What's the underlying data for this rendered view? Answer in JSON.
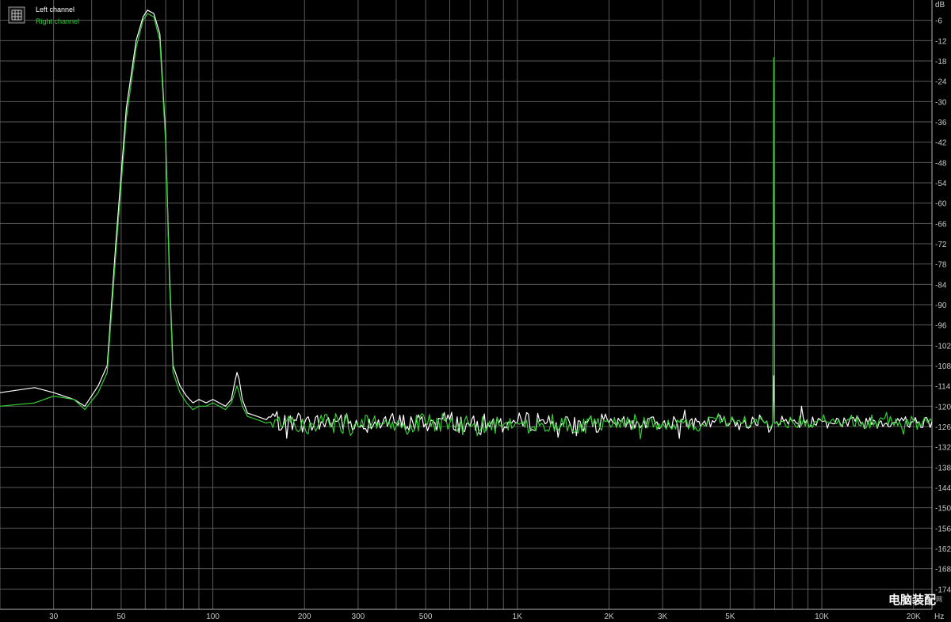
{
  "chart_data": {
    "type": "line",
    "title": "",
    "xlabel": "",
    "ylabel": "",
    "y_unit": "dB",
    "x_unit": "Hz",
    "x_scale": "log",
    "xlim": [
      20,
      23000
    ],
    "ylim": [
      -180,
      0
    ],
    "grid": true,
    "legend_position": "top-left",
    "background_color": "#000000",
    "grid_color": "#5a5a5a",
    "x_tick_labels": [
      "30",
      "50",
      "100",
      "200",
      "300",
      "500",
      "1K",
      "2K",
      "3K",
      "5K",
      "10K",
      "20K"
    ],
    "x_tick_values": [
      30,
      50,
      100,
      200,
      300,
      500,
      1000,
      2000,
      3000,
      5000,
      10000,
      20000
    ],
    "y_tick_values": [
      -6,
      -12,
      -18,
      -24,
      -30,
      -36,
      -42,
      -48,
      -54,
      -60,
      -66,
      -72,
      -78,
      -84,
      -90,
      -96,
      -102,
      -108,
      -114,
      -120,
      -126,
      -132,
      -138,
      -144,
      -150,
      -156,
      -162,
      -168,
      -174
    ],
    "y_tick_labels": [
      "-6",
      "-12",
      "-18",
      "-24",
      "-30",
      "-36",
      "-42",
      "-48",
      "-54",
      "-60",
      "-66",
      "-72",
      "-78",
      "-84",
      "-90",
      "-96",
      "-102",
      "-108",
      "-114",
      "-120",
      "-126",
      "-132",
      "-138",
      "-144",
      "-150",
      "-156",
      "-162",
      "-168",
      "-174"
    ],
    "noise_floor_db": -125,
    "series": [
      {
        "name": "Left channel",
        "color": "#ffffff",
        "x": [
          20,
          26,
          30,
          35,
          38,
          42,
          45,
          48,
          52,
          56,
          59,
          61,
          64,
          67,
          70,
          72,
          74,
          78,
          82,
          86,
          90,
          95,
          100,
          105,
          110,
          115,
          118,
          120,
          122,
          125,
          130,
          140,
          150,
          160,
          170,
          185,
          200,
          230,
          260,
          300,
          350,
          400,
          500,
          600,
          700,
          800,
          1000,
          1200,
          1500,
          2000,
          2500,
          3000,
          3500,
          4000,
          4500,
          5000,
          5500,
          6000,
          6500,
          6900,
          6950,
          7000,
          7050,
          7100,
          7500,
          8000,
          10000,
          12000,
          15000,
          18000,
          20000,
          23000
        ],
        "y": [
          -116,
          -114.5,
          -116,
          -118,
          -120,
          -114,
          -108,
          -72,
          -32,
          -12,
          -5,
          -3,
          -4,
          -10,
          -40,
          -80,
          -108,
          -114,
          -117,
          -119,
          -118,
          -119,
          -118,
          -119,
          -120,
          -118,
          -113,
          -110,
          -112,
          -118,
          -122,
          -123,
          -124,
          -123,
          -126,
          -124,
          -125,
          -125,
          -124,
          -126,
          -124,
          -125,
          -125,
          -124,
          -126,
          -125,
          -125,
          -124,
          -126,
          -125,
          -125,
          -125,
          -124,
          -126,
          -124,
          -125,
          -125,
          -124,
          -125,
          -125,
          -111,
          -125,
          -125,
          -124.5,
          -124.5,
          -124.5,
          -124.5,
          -124.5,
          -124.5,
          -124.5,
          -124.5,
          -124.5
        ]
      },
      {
        "name": "Right channel",
        "color": "#33cc33",
        "x": [
          20,
          26,
          30,
          35,
          38,
          42,
          45,
          48,
          52,
          56,
          59,
          61,
          64,
          67,
          70,
          72,
          74,
          78,
          82,
          86,
          90,
          95,
          100,
          105,
          110,
          115,
          118,
          120,
          122,
          125,
          130,
          140,
          150,
          160,
          170,
          185,
          200,
          230,
          260,
          300,
          350,
          400,
          500,
          600,
          700,
          800,
          1000,
          1200,
          1500,
          2000,
          2500,
          3000,
          3500,
          4000,
          4500,
          5000,
          5500,
          6000,
          6500,
          6900,
          6950,
          7000,
          7050,
          7100,
          7500,
          8000,
          10000,
          12000,
          15000,
          18000,
          20000,
          23000
        ],
        "y": [
          -120,
          -119,
          -117,
          -118,
          -121,
          -116,
          -110,
          -75,
          -35,
          -14,
          -6,
          -4,
          -5,
          -12,
          -42,
          -82,
          -110,
          -116,
          -119,
          -121,
          -120,
          -120,
          -119,
          -120,
          -121,
          -119,
          -116,
          -114,
          -116,
          -120,
          -123,
          -124,
          -125,
          -124,
          -126,
          -125,
          -126,
          -125,
          -125,
          -126,
          -125,
          -126,
          -125,
          -125,
          -126,
          -126,
          -125,
          -125,
          -126,
          -125,
          -125,
          -125,
          -125,
          -126,
          -124,
          -125,
          -125,
          -124,
          -125,
          -125,
          -17,
          -125,
          -125,
          -124.5,
          -124.5,
          -124.5,
          -124.5,
          -124.5,
          -124.5,
          -124.5,
          -124.5,
          -124.5
        ]
      }
    ]
  },
  "legend_icon": "chart-legend-grid-icon",
  "watermark": {
    "main": "电脑装配",
    "small": "网"
  }
}
